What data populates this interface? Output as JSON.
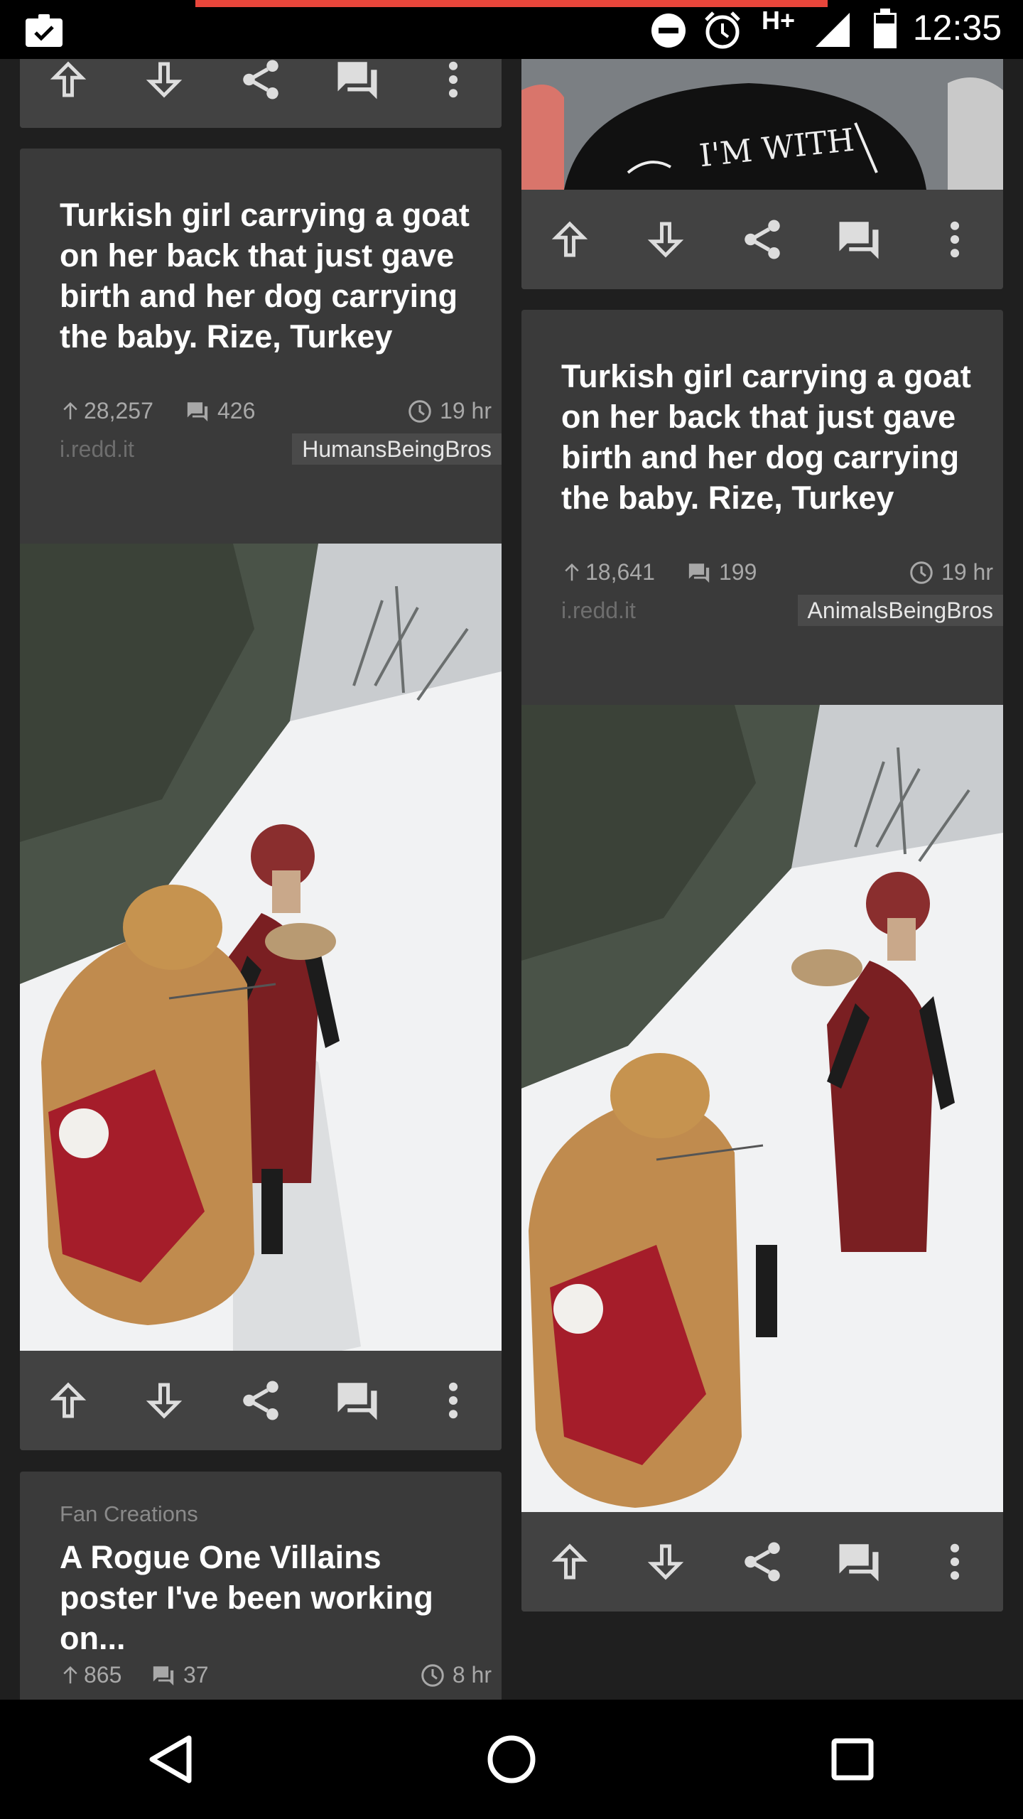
{
  "status_bar": {
    "time": "12:35",
    "network": "H+",
    "icons": [
      "clipboard-check-icon",
      "do-not-disturb-icon",
      "alarm-icon",
      "signal-icon",
      "battery-icon"
    ]
  },
  "colors": {
    "background": "#1f1f1f",
    "card": "#3a3a3a",
    "action_bar": "#424242",
    "progress": "#e8463b"
  },
  "action_bar_icons": [
    "upvote-icon",
    "downvote-icon",
    "share-icon",
    "comments-icon",
    "more-icon"
  ],
  "posts": [
    {
      "title": "Turkish girl carrying a goat on her back that just gave birth and her dog carrying the baby. Rize, Turkey",
      "score": "28,257",
      "comments": "426",
      "age": "19 hr",
      "domain": "i.redd.it",
      "subreddit": "HumansBeingBros"
    },
    {
      "title": "Turkish girl carrying a goat on her back that just gave birth and her dog carrying the baby. Rize, Turkey",
      "score": "18,641",
      "comments": "199",
      "age": "19 hr",
      "domain": "i.redd.it",
      "subreddit": "AnimalsBeingBros"
    },
    {
      "flair": "Fan Creations",
      "title": "A Rogue One Villains poster I've been working on...",
      "score": "865",
      "comments": "37",
      "age": "8 hr"
    }
  ],
  "partial_image_text": "I'M WITH",
  "nav_bar": {
    "icons": [
      "back-icon",
      "home-icon",
      "recents-icon"
    ]
  }
}
